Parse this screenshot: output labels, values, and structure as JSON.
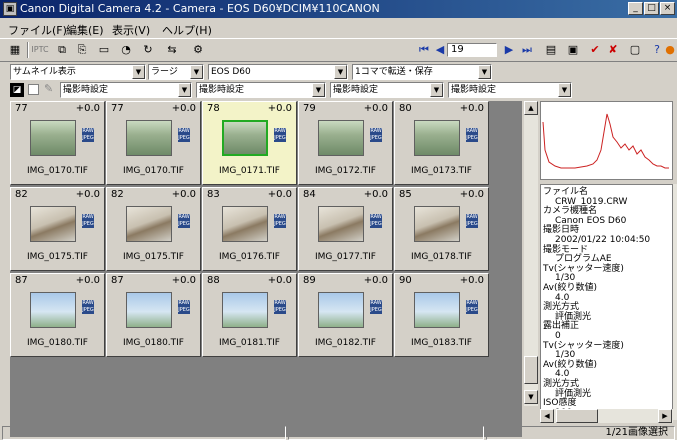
{
  "window": {
    "title": "Canon Digital Camera 4.2 - Camera - EOS D60¥DCIM¥110CANON",
    "app_icon": "camera-icon"
  },
  "menu": [
    "ファイル(F)",
    "編集(E)",
    "表示(V)",
    "ヘルプ(H)"
  ],
  "toolbar": {
    "frame_number": "19"
  },
  "combos": {
    "view_mode": "サムネイル表示",
    "size": "ラージ",
    "camera": "EOS D60",
    "transfer": "1コマで転送・保存",
    "sort1": "撮影時設定",
    "sort2": "撮影時設定",
    "sort3": "撮影時設定",
    "sort4": "撮影時設定"
  },
  "thumbnails": [
    {
      "num": "77",
      "ev": "+0.0",
      "name": "IMG_0170.TIF",
      "style": "window",
      "selected": false
    },
    {
      "num": "77",
      "ev": "+0.0",
      "name": "IMG_0170.TIF",
      "style": "window",
      "selected": false
    },
    {
      "num": "78",
      "ev": "+0.0",
      "name": "IMG_0171.TIF",
      "style": "window",
      "selected": true
    },
    {
      "num": "79",
      "ev": "+0.0",
      "name": "IMG_0172.TIF",
      "style": "window",
      "selected": false
    },
    {
      "num": "80",
      "ev": "+0.0",
      "name": "IMG_0173.TIF",
      "style": "window",
      "selected": false
    },
    {
      "num": "82",
      "ev": "+0.0",
      "name": "IMG_0175.TIF",
      "style": "flower",
      "selected": false
    },
    {
      "num": "82",
      "ev": "+0.0",
      "name": "IMG_0175.TIF",
      "style": "flower",
      "selected": false
    },
    {
      "num": "83",
      "ev": "+0.0",
      "name": "IMG_0176.TIF",
      "style": "flower",
      "selected": false
    },
    {
      "num": "84",
      "ev": "+0.0",
      "name": "IMG_0177.TIF",
      "style": "flower",
      "selected": false
    },
    {
      "num": "85",
      "ev": "+0.0",
      "name": "IMG_0178.TIF",
      "style": "flower",
      "selected": false
    },
    {
      "num": "87",
      "ev": "+0.0",
      "name": "IMG_0180.TIF",
      "style": "sky",
      "selected": false
    },
    {
      "num": "87",
      "ev": "+0.0",
      "name": "IMG_0180.TIF",
      "style": "sky",
      "selected": false
    },
    {
      "num": "88",
      "ev": "+0.0",
      "name": "IMG_0181.TIF",
      "style": "sky",
      "selected": false
    },
    {
      "num": "89",
      "ev": "+0.0",
      "name": "IMG_0182.TIF",
      "style": "sky",
      "selected": false
    },
    {
      "num": "90",
      "ev": "+0.0",
      "name": "IMG_0183.TIF",
      "style": "sky",
      "selected": false
    }
  ],
  "badge": {
    "line1": "RAW",
    "line2": "JPEG"
  },
  "info": [
    {
      "text": "ファイル名",
      "value": false
    },
    {
      "text": "CRW_1019.CRW",
      "value": true
    },
    {
      "text": "カメラ機種名",
      "value": false
    },
    {
      "text": "Canon EOS D60",
      "value": true
    },
    {
      "text": "撮影日時",
      "value": false
    },
    {
      "text": "2002/01/22 10:04:50",
      "value": true
    },
    {
      "text": "撮影モード",
      "value": false
    },
    {
      "text": "プログラムAE",
      "value": true
    },
    {
      "text": "Tv(シャッター速度)",
      "value": false
    },
    {
      "text": "1/30",
      "value": true
    },
    {
      "text": "Av(絞り数値)",
      "value": false
    },
    {
      "text": "4.0",
      "value": true
    },
    {
      "text": "測光方式",
      "value": false
    },
    {
      "text": "評価測光",
      "value": true
    },
    {
      "text": "露出補正",
      "value": false
    },
    {
      "text": "0",
      "value": true
    },
    {
      "text": "Tv(シャッター速度)",
      "value": false
    },
    {
      "text": "1/30",
      "value": true
    },
    {
      "text": "Av(絞り数値)",
      "value": false
    },
    {
      "text": "4.0",
      "value": true
    },
    {
      "text": "測光方式",
      "value": false
    },
    {
      "text": "評価測光",
      "value": true
    },
    {
      "text": "ISO感度",
      "value": false
    },
    {
      "text": "100",
      "value": true
    }
  ],
  "status": {
    "selection": "1/21画像選択"
  },
  "colors": {
    "selected_bg": "#f3f3c8",
    "selected_border": "#22aa22",
    "histogram_line": "#cc2222"
  }
}
